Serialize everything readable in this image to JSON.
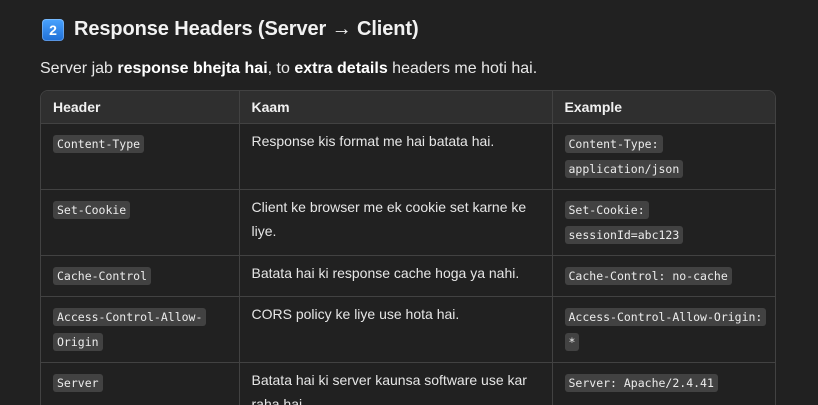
{
  "heading": {
    "badge": "2",
    "title": "Response Headers (Server → Client)"
  },
  "intro": {
    "part1": "Server jab ",
    "bold1": "response bhejta hai",
    "part2": ", to ",
    "bold2": "extra details",
    "part3": " headers me hoti hai."
  },
  "table": {
    "columns": [
      "Header",
      "Kaam",
      "Example"
    ],
    "rows": [
      {
        "header": "Content-Type",
        "kaam": "Response kis format me hai batata hai.",
        "example": "Content-Type: application/json"
      },
      {
        "header": "Set-Cookie",
        "kaam": "Client ke browser me ek cookie set karne ke liye.",
        "example": "Set-Cookie: sessionId=abc123"
      },
      {
        "header": "Cache-Control",
        "kaam": "Batata hai ki response cache hoga ya nahi.",
        "example": "Cache-Control: no-cache"
      },
      {
        "header": "Access-Control-Allow-Origin",
        "kaam": "CORS policy ke liye use hota hai.",
        "example": "Access-Control-Allow-Origin: *"
      },
      {
        "header": "Server",
        "kaam": "Batata hai ki server kaunsa software use kar raha hai.",
        "example": "Server: Apache/2.4.41"
      }
    ]
  },
  "colors": {
    "background": "#212121",
    "table_header": "#2f2f2f",
    "border": "#424242",
    "code_bg": "#424242",
    "keycap": "#2a85f0"
  }
}
